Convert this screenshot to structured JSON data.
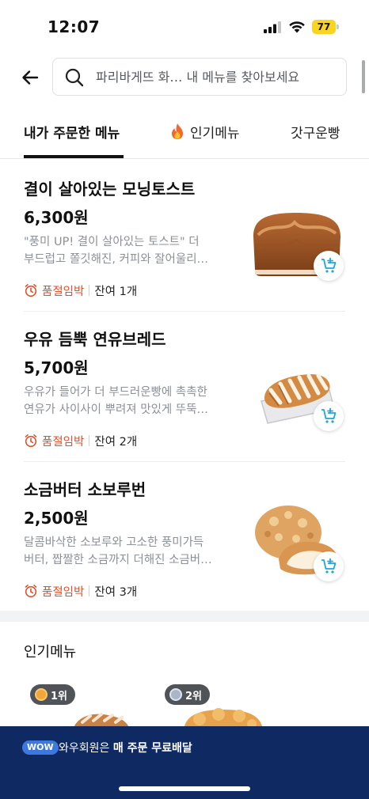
{
  "status_bar": {
    "time": "12:07",
    "battery": "77"
  },
  "search": {
    "placeholder": "파리바게뜨 화… 내 메뉴를 찾아보세요"
  },
  "tabs": [
    {
      "label": "내가 주문한 메뉴",
      "active": true
    },
    {
      "label": "인기메뉴",
      "icon": "fire-icon"
    },
    {
      "label": "갓구운빵"
    }
  ],
  "menu_items": [
    {
      "name": "결이 살아있는 모닝토스트",
      "price": "6,300원",
      "desc_line1": "\"풍미 UP! 결이 살아있는 토스트\" 더",
      "desc_line2": "부드럽고 쫄깃해진, 커피와 잘어울리…",
      "stock_status": "품절임박",
      "stock_remaining": "잔여 1개"
    },
    {
      "name": "우유 듬뿍 연유브레드",
      "price": "5,700원",
      "desc_line1": "우유가 들어가 더 부드러운빵에 촉촉한",
      "desc_line2": "연유가 사이사이 뿌려져 맛있게 뚜뚝…",
      "stock_status": "품절임박",
      "stock_remaining": "잔여 2개"
    },
    {
      "name": "소금버터 소보루번",
      "price": "2,500원",
      "desc_line1": "달콤바삭한 소보루와 고소한 풍미가득",
      "desc_line2": "버터, 짭짤한 소금까지 더해진 소금버…",
      "stock_status": "품절임박",
      "stock_remaining": "잔여 3개"
    }
  ],
  "popular": {
    "title": "인기메뉴",
    "ranks": [
      "1위",
      "2위"
    ]
  },
  "wow_banner": {
    "badge": "WOW",
    "text_prefix": "와우회원은 ",
    "text_bold": "매 주문 무료배달"
  },
  "colors": {
    "warning": "#e0512c",
    "cart_accent": "#1ea7d9",
    "banner_bg": "#0f2a63"
  }
}
